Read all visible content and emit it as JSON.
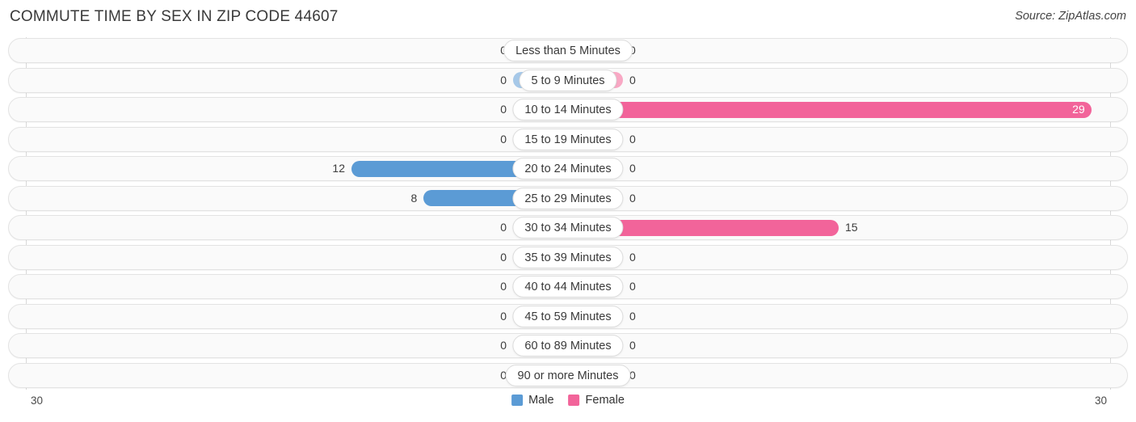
{
  "header": {
    "title": "COMMUTE TIME BY SEX IN ZIP CODE 44607",
    "source": "Source: ZipAtlas.com"
  },
  "legend": {
    "male_label": "Male",
    "female_label": "Female",
    "male_color": "#5B9BD5",
    "female_color": "#F2649A",
    "male_zero_color": "#A6C8E8",
    "female_zero_color": "#F8A8C4"
  },
  "axis": {
    "left_tick": "30",
    "right_tick": "30",
    "max": 30
  },
  "chart_data": {
    "type": "bar",
    "title": "COMMUTE TIME BY SEX IN ZIP CODE 44607",
    "subtitle": "Source: ZipAtlas.com",
    "orientation": "horizontal-diverging",
    "xlabel": "",
    "ylabel": "",
    "xlim": [
      30,
      30
    ],
    "grid": false,
    "legend_position": "bottom-center",
    "categories": [
      "Less than 5 Minutes",
      "5 to 9 Minutes",
      "10 to 14 Minutes",
      "15 to 19 Minutes",
      "20 to 24 Minutes",
      "25 to 29 Minutes",
      "30 to 34 Minutes",
      "35 to 39 Minutes",
      "40 to 44 Minutes",
      "45 to 59 Minutes",
      "60 to 89 Minutes",
      "90 or more Minutes"
    ],
    "series": [
      {
        "name": "Male",
        "direction": "left",
        "values": [
          0,
          0,
          0,
          0,
          12,
          8,
          0,
          0,
          0,
          0,
          0,
          0
        ]
      },
      {
        "name": "Female",
        "direction": "right",
        "values": [
          0,
          0,
          29,
          0,
          0,
          0,
          15,
          0,
          0,
          0,
          0,
          0
        ]
      }
    ]
  },
  "rows": [
    {
      "label": "Less than 5 Minutes",
      "male": "0",
      "female": "0"
    },
    {
      "label": "5 to 9 Minutes",
      "male": "0",
      "female": "0"
    },
    {
      "label": "10 to 14 Minutes",
      "male": "0",
      "female": "29"
    },
    {
      "label": "15 to 19 Minutes",
      "male": "0",
      "female": "0"
    },
    {
      "label": "20 to 24 Minutes",
      "male": "12",
      "female": "0"
    },
    {
      "label": "25 to 29 Minutes",
      "male": "8",
      "female": "0"
    },
    {
      "label": "30 to 34 Minutes",
      "male": "0",
      "female": "15"
    },
    {
      "label": "35 to 39 Minutes",
      "male": "0",
      "female": "0"
    },
    {
      "label": "40 to 44 Minutes",
      "male": "0",
      "female": "0"
    },
    {
      "label": "45 to 59 Minutes",
      "male": "0",
      "female": "0"
    },
    {
      "label": "60 to 89 Minutes",
      "male": "0",
      "female": "0"
    },
    {
      "label": "90 or more Minutes",
      "male": "0",
      "female": "0"
    }
  ]
}
